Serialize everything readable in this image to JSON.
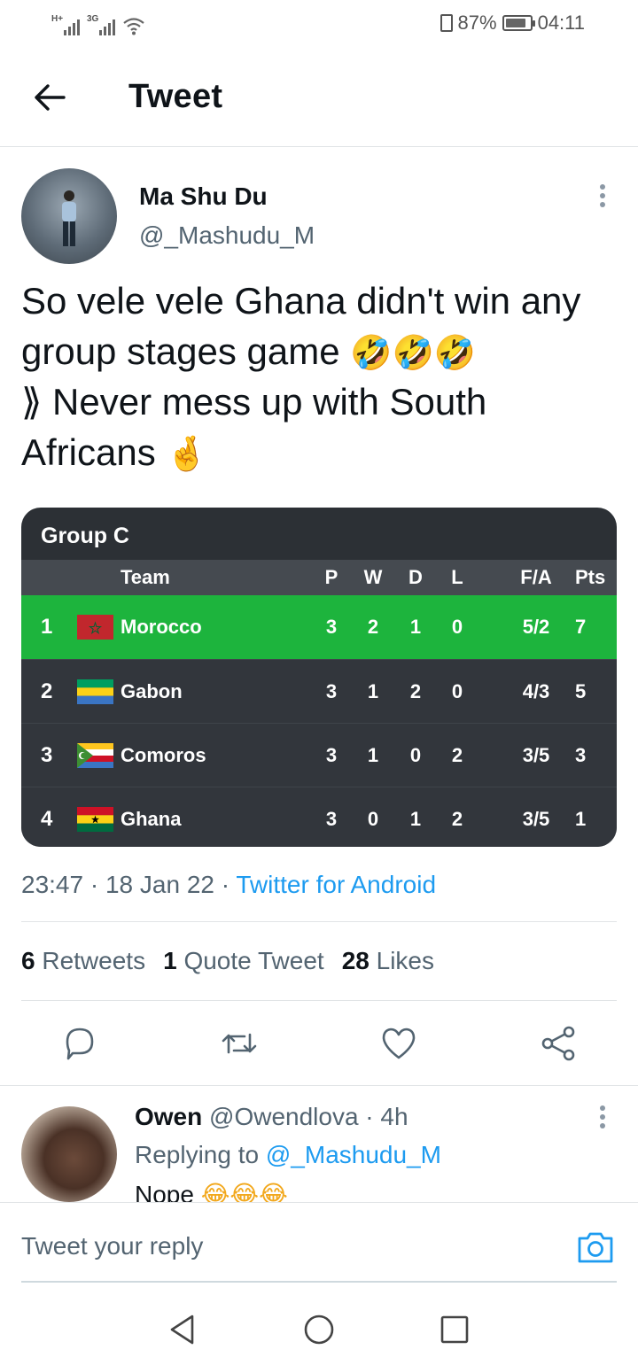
{
  "status_bar": {
    "signal1_tag": "H+",
    "signal2_tag": "3G",
    "battery_percent": "87%",
    "battery_level": 0.87,
    "time": "04:11",
    "icons": [
      "signal-icon",
      "wifi-icon",
      "vibrate-icon",
      "battery-icon"
    ]
  },
  "header": {
    "title": "Tweet",
    "back_icon": "arrow-left-icon"
  },
  "tweet": {
    "author_name": "Ma Shu Du",
    "author_handle": "@_Mashudu_M",
    "text_lines": [
      "So vele vele  Ghana didn't win any",
      "group stages game",
      "⟫ Never mess up with South",
      "Africans"
    ],
    "line2_emoji": "🤣🤣🤣",
    "line4_emoji": "🤞",
    "time": "23:47",
    "date": "18 Jan 22",
    "source": "Twitter for Android",
    "retweets_count": "6",
    "retweets_label": "Retweets",
    "quotes_count": "1",
    "quotes_label": "Quote Tweet",
    "likes_count": "28",
    "likes_label": "Likes"
  },
  "standings": {
    "title": "Group C",
    "headers": {
      "team": "Team",
      "p": "P",
      "w": "W",
      "d": "D",
      "l": "L",
      "fa": "F/A",
      "pts": "Pts"
    },
    "rows": [
      {
        "pos": "1",
        "team": "Morocco",
        "p": "3",
        "w": "2",
        "d": "1",
        "l": "0",
        "fa": "5/2",
        "pts": "7",
        "flag": "morocco-flag"
      },
      {
        "pos": "2",
        "team": "Gabon",
        "p": "3",
        "w": "1",
        "d": "2",
        "l": "0",
        "fa": "4/3",
        "pts": "5",
        "flag": "gabon-flag"
      },
      {
        "pos": "3",
        "team": "Comoros",
        "p": "3",
        "w": "1",
        "d": "0",
        "l": "2",
        "fa": "3/5",
        "pts": "3",
        "flag": "comoros-flag"
      },
      {
        "pos": "4",
        "team": "Ghana",
        "p": "3",
        "w": "0",
        "d": "1",
        "l": "2",
        "fa": "3/5",
        "pts": "1",
        "flag": "ghana-flag"
      }
    ],
    "colors": {
      "card_bg": "#2c3035",
      "header_bg": "#454a50",
      "leader_bg": "#1db43d"
    }
  },
  "actions": [
    "reply-icon",
    "retweet-icon",
    "like-icon",
    "share-icon"
  ],
  "reply": {
    "author_name": "Owen",
    "author_handle": "@Owendlova",
    "time": "4h",
    "replying_prefix": "Replying to",
    "replying_to": "@_Mashudu_M",
    "text": "Nope",
    "emoji": "😂😂😂"
  },
  "compose": {
    "placeholder": "Tweet your reply",
    "camera_icon": "camera-icon"
  },
  "nav": [
    "back-triangle-icon",
    "home-circle-icon",
    "recents-square-icon"
  ],
  "colors": {
    "link_blue": "#1d9bf0",
    "secondary_text": "#536471",
    "primary_text": "#0f1419"
  }
}
